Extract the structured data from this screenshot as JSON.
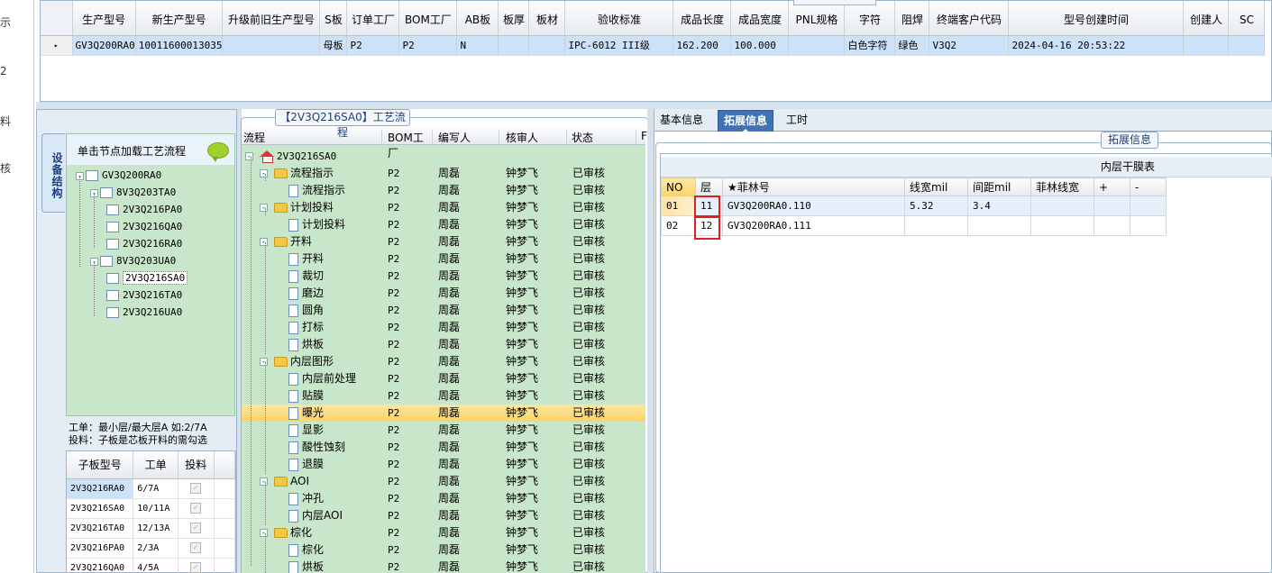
{
  "left_strip": {
    "labels": [
      "示",
      "2",
      "料",
      "核"
    ]
  },
  "top_grid": {
    "columns": [
      "生产型号",
      "新生产型号",
      "升级前旧生产型号",
      "S板",
      "订单工厂",
      "BOM工厂",
      "AB板",
      "板厚",
      "板材",
      "验收标准",
      "成品长度",
      "成品宽度",
      "PNL规格",
      "字符",
      "阻焊",
      "终端客户代码",
      "型号创建时间",
      "创建人",
      "SC"
    ],
    "row": {
      "indicator": "▸",
      "cells": [
        "GV3Q200RA0",
        "10011600013035",
        "",
        "母板",
        "P2",
        "P2",
        "N",
        "",
        "",
        "IPC-6012 III级",
        "162.200",
        "100.000",
        "",
        "白色字符",
        "绿色",
        "V3Q2",
        "2024-04-16 20:53:22",
        "",
        ""
      ]
    }
  },
  "left_panel": {
    "vertical_tab": "设备结构",
    "header": "单击节点加载工艺流程",
    "tree": [
      {
        "label": "GV3Q200RA0",
        "pm": "-"
      },
      {
        "label": "8V3Q203TA0",
        "pm": "-"
      },
      {
        "label": "2V3Q216PA0"
      },
      {
        "label": "2V3Q216QA0"
      },
      {
        "label": "2V3Q216RA0"
      },
      {
        "label": "8V3Q203UA0",
        "pm": "-"
      },
      {
        "label": "2V3Q216SA0"
      },
      {
        "label": "2V3Q216TA0"
      },
      {
        "label": "2V3Q216UA0"
      }
    ],
    "note_line1": "工单：最小层/最大层A 如:2/7A",
    "note_line2": "投料：子板是芯板开料的需勾选",
    "sub_grid": {
      "columns": [
        "子板型号",
        "工单",
        "投料"
      ],
      "rows": [
        [
          "2V3Q216RA0",
          "6/7A",
          "✓"
        ],
        [
          "2V3Q216SA0",
          "10/11A",
          "✓"
        ],
        [
          "2V3Q216TA0",
          "12/13A",
          "✓"
        ],
        [
          "2V3Q216PA0",
          "2/3A",
          "✓"
        ],
        [
          "2V3Q216QA0",
          "4/5A",
          "✓"
        ]
      ]
    }
  },
  "process_flow": {
    "title": "【2V3Q216SA0】工艺流程",
    "columns": [
      "流程",
      "BOM工厂",
      "编写人",
      "核审人",
      "状态",
      "F"
    ],
    "root": "2V3Q216SA0",
    "rows": [
      {
        "name": "流程指示",
        "type": "folder",
        "bom": "P2",
        "writer": "周磊",
        "reviewer": "钟梦飞",
        "status": "已审核"
      },
      {
        "name": "流程指示",
        "type": "leaf",
        "bom": "P2",
        "writer": "周磊",
        "reviewer": "钟梦飞",
        "status": "已审核"
      },
      {
        "name": "计划投料",
        "type": "folder",
        "bom": "P2",
        "writer": "周磊",
        "reviewer": "钟梦飞",
        "status": "已审核"
      },
      {
        "name": "计划投料",
        "type": "leaf",
        "bom": "P2",
        "writer": "周磊",
        "reviewer": "钟梦飞",
        "status": "已审核"
      },
      {
        "name": "开料",
        "type": "folder",
        "bom": "P2",
        "writer": "周磊",
        "reviewer": "钟梦飞",
        "status": "已审核"
      },
      {
        "name": "开料",
        "type": "leaf",
        "bom": "P2",
        "writer": "周磊",
        "reviewer": "钟梦飞",
        "status": "已审核"
      },
      {
        "name": "裁切",
        "type": "leaf",
        "bom": "P2",
        "writer": "周磊",
        "reviewer": "钟梦飞",
        "status": "已审核"
      },
      {
        "name": "磨边",
        "type": "leaf",
        "bom": "P2",
        "writer": "周磊",
        "reviewer": "钟梦飞",
        "status": "已审核"
      },
      {
        "name": "圆角",
        "type": "leaf",
        "bom": "P2",
        "writer": "周磊",
        "reviewer": "钟梦飞",
        "status": "已审核"
      },
      {
        "name": "打标",
        "type": "leaf",
        "bom": "P2",
        "writer": "周磊",
        "reviewer": "钟梦飞",
        "status": "已审核"
      },
      {
        "name": "烘板",
        "type": "leaf",
        "bom": "P2",
        "writer": "周磊",
        "reviewer": "钟梦飞",
        "status": "已审核"
      },
      {
        "name": "内层图形",
        "type": "folder",
        "bom": "P2",
        "writer": "周磊",
        "reviewer": "钟梦飞",
        "status": "已审核"
      },
      {
        "name": "内层前处理",
        "type": "leaf",
        "bom": "P2",
        "writer": "周磊",
        "reviewer": "钟梦飞",
        "status": "已审核"
      },
      {
        "name": "贴膜",
        "type": "leaf",
        "bom": "P2",
        "writer": "周磊",
        "reviewer": "钟梦飞",
        "status": "已审核"
      },
      {
        "name": "曝光",
        "type": "leaf",
        "bom": "P2",
        "writer": "周磊",
        "reviewer": "钟梦飞",
        "status": "已审核",
        "selected": true
      },
      {
        "name": "显影",
        "type": "leaf",
        "bom": "P2",
        "writer": "周磊",
        "reviewer": "钟梦飞",
        "status": "已审核"
      },
      {
        "name": "酸性蚀刻",
        "type": "leaf",
        "bom": "P2",
        "writer": "周磊",
        "reviewer": "钟梦飞",
        "status": "已审核"
      },
      {
        "name": "退膜",
        "type": "leaf",
        "bom": "P2",
        "writer": "周磊",
        "reviewer": "钟梦飞",
        "status": "已审核"
      },
      {
        "name": "AOI",
        "type": "folder",
        "bom": "P2",
        "writer": "周磊",
        "reviewer": "钟梦飞",
        "status": "已审核"
      },
      {
        "name": "冲孔",
        "type": "leaf",
        "bom": "P2",
        "writer": "周磊",
        "reviewer": "钟梦飞",
        "status": "已审核"
      },
      {
        "name": "内层AOI",
        "type": "leaf",
        "bom": "P2",
        "writer": "周磊",
        "reviewer": "钟梦飞",
        "status": "已审核"
      },
      {
        "name": "棕化",
        "type": "folder",
        "bom": "P2",
        "writer": "周磊",
        "reviewer": "钟梦飞",
        "status": "已审核"
      },
      {
        "name": "棕化",
        "type": "leaf",
        "bom": "P2",
        "writer": "周磊",
        "reviewer": "钟梦飞",
        "status": "已审核"
      },
      {
        "name": "烘板",
        "type": "leaf",
        "bom": "P2",
        "writer": "周磊",
        "reviewer": "钟梦飞",
        "status": "已审核"
      }
    ]
  },
  "right_panel": {
    "tabs": [
      "基本信息",
      "拓展信息",
      "工时"
    ],
    "active_tab": 1,
    "group_label": "拓展信息",
    "table_title": "内层干膜表",
    "columns": [
      "NO",
      "层",
      "★菲林号",
      "线宽mil",
      "间距mil",
      "菲林线宽",
      "+",
      "-"
    ],
    "rows": [
      [
        "01",
        "11",
        "GV3Q200RA0.110",
        "5.32",
        "3.4",
        "",
        "",
        ""
      ],
      [
        "02",
        "12",
        "GV3Q200RA0.111",
        "",
        "",
        "",
        "",
        ""
      ]
    ]
  }
}
